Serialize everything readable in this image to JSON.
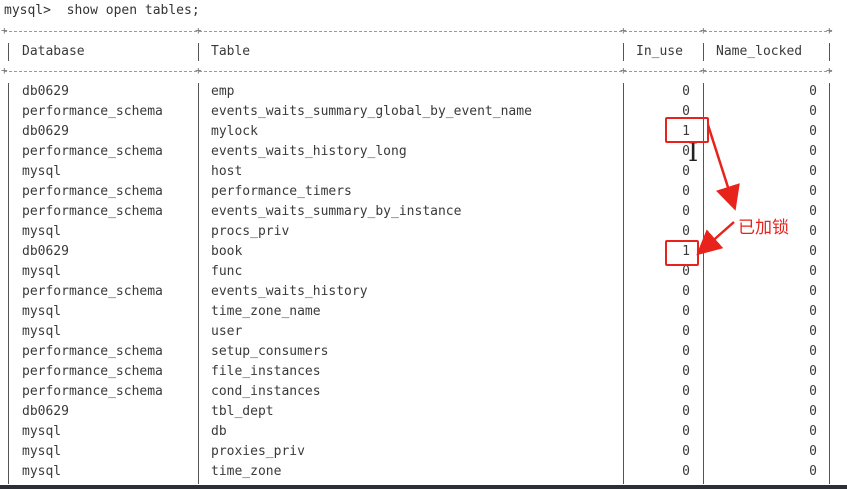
{
  "terminal": {
    "prompt": "mysql>  show open tables;",
    "columns": [
      "Database",
      "Table",
      "In_use",
      "Name_locked"
    ],
    "rows": [
      [
        "db0629",
        "emp",
        "0",
        "0"
      ],
      [
        "performance_schema",
        "events_waits_summary_global_by_event_name",
        "0",
        "0"
      ],
      [
        "db0629",
        "mylock",
        "1",
        "0"
      ],
      [
        "performance_schema",
        "events_waits_history_long",
        "0",
        "0"
      ],
      [
        "mysql",
        "host",
        "0",
        "0"
      ],
      [
        "performance_schema",
        "performance_timers",
        "0",
        "0"
      ],
      [
        "performance_schema",
        "events_waits_summary_by_instance",
        "0",
        "0"
      ],
      [
        "mysql",
        "procs_priv",
        "0",
        "0"
      ],
      [
        "db0629",
        "book",
        "1",
        "0"
      ],
      [
        "mysql",
        "func",
        "0",
        "0"
      ],
      [
        "performance_schema",
        "events_waits_history",
        "0",
        "0"
      ],
      [
        "mysql",
        "time_zone_name",
        "0",
        "0"
      ],
      [
        "mysql",
        "user",
        "0",
        "0"
      ],
      [
        "performance_schema",
        "setup_consumers",
        "0",
        "0"
      ],
      [
        "performance_schema",
        "file_instances",
        "0",
        "0"
      ],
      [
        "performance_schema",
        "cond_instances",
        "0",
        "0"
      ],
      [
        "db0629",
        "tbl_dept",
        "0",
        "0"
      ],
      [
        "mysql",
        "db",
        "0",
        "0"
      ],
      [
        "mysql",
        "proxies_priv",
        "0",
        "0"
      ],
      [
        "mysql",
        "time_zone",
        "0",
        "0"
      ]
    ]
  },
  "annotation": {
    "text": "已加锁",
    "color": "#e8231c"
  }
}
